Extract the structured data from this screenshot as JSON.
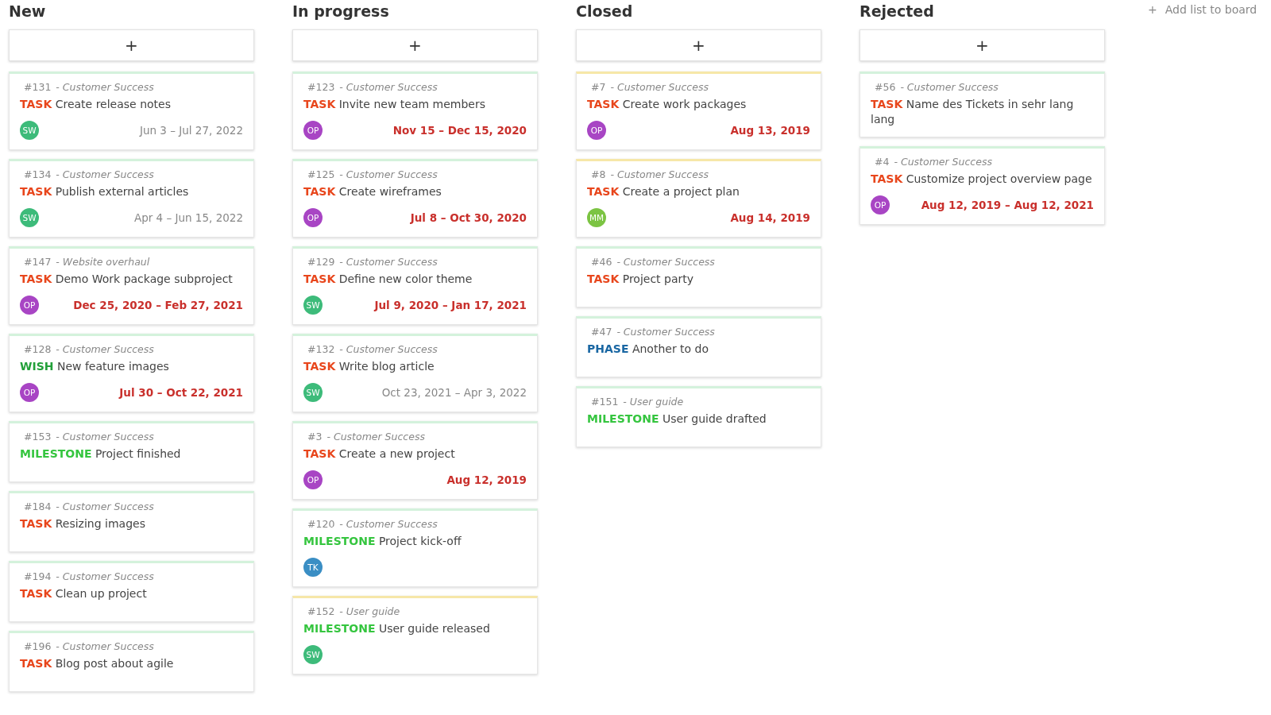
{
  "add_list": {
    "icon": "+",
    "label": "Add list to board"
  },
  "columns": [
    {
      "title": "New",
      "add_button": "+",
      "cards": [
        {
          "number": "#131",
          "project": "- Customer Success",
          "kind": "task",
          "type": "TASK",
          "subject": "Create release notes",
          "color": "#d4f2dc",
          "avatar": {
            "initials": "SW",
            "color": "#3dbb7a"
          },
          "dates": "Jun 3 – Jul 27, 2022",
          "overdue": false
        },
        {
          "number": "#134",
          "project": "- Customer Success",
          "kind": "task",
          "type": "TASK",
          "subject": "Publish external articles",
          "color": "#d4f2dc",
          "avatar": {
            "initials": "SW",
            "color": "#3dbb7a"
          },
          "dates": "Apr 4 – Jun 15, 2022",
          "overdue": false
        },
        {
          "number": "#147",
          "project": "- Website overhaul",
          "kind": "task",
          "type": "TASK",
          "subject": "Demo Work package subproject",
          "color": "#d4f2dc",
          "avatar": {
            "initials": "OP",
            "color": "#a845c4"
          },
          "dates": "Dec 25, 2020 – Feb 27, 2021",
          "overdue": true
        },
        {
          "number": "#128",
          "project": "- Customer Success",
          "kind": "wish",
          "type": "WISH",
          "subject": "New feature images",
          "color": "#d4f2dc",
          "avatar": {
            "initials": "OP",
            "color": "#a845c4"
          },
          "dates": "Jul 30 – Oct 22, 2021",
          "overdue": true
        },
        {
          "number": "#153",
          "project": "- Customer Success",
          "kind": "milestone",
          "type": "MILESTONE",
          "subject": "Project finished",
          "color": "#d4f2dc"
        },
        {
          "number": "#184",
          "project": "- Customer Success",
          "kind": "task",
          "type": "TASK",
          "subject": "Resizing images",
          "color": "#d4f2dc"
        },
        {
          "number": "#194",
          "project": "- Customer Success",
          "kind": "task",
          "type": "TASK",
          "subject": "Clean up project",
          "color": "#d4f2dc"
        },
        {
          "number": "#196",
          "project": "- Customer Success",
          "kind": "task",
          "type": "TASK",
          "subject": "Blog post about agile",
          "color": "#d4f2dc"
        }
      ]
    },
    {
      "title": "In progress",
      "add_button": "+",
      "cards": [
        {
          "number": "#123",
          "project": "- Customer Success",
          "kind": "task",
          "type": "TASK",
          "subject": "Invite new team members",
          "color": "#d4f2dc",
          "avatar": {
            "initials": "OP",
            "color": "#a845c4"
          },
          "dates": "Nov 15 – Dec 15, 2020",
          "overdue": true
        },
        {
          "number": "#125",
          "project": "- Customer Success",
          "kind": "task",
          "type": "TASK",
          "subject": "Create wireframes",
          "color": "#d4f2dc",
          "avatar": {
            "initials": "OP",
            "color": "#a845c4"
          },
          "dates": "Jul 8 – Oct 30, 2020",
          "overdue": true
        },
        {
          "number": "#129",
          "project": "- Customer Success",
          "kind": "task",
          "type": "TASK",
          "subject": "Define new color theme",
          "color": "#d4f2dc",
          "avatar": {
            "initials": "SW",
            "color": "#3dbb7a"
          },
          "dates": "Jul 9, 2020 – Jan 17, 2021",
          "overdue": true
        },
        {
          "number": "#132",
          "project": "- Customer Success",
          "kind": "task",
          "type": "TASK",
          "subject": "Write blog article",
          "color": "#d4f2dc",
          "avatar": {
            "initials": "SW",
            "color": "#3dbb7a"
          },
          "dates": "Oct 23, 2021 – Apr 3, 2022",
          "overdue": false
        },
        {
          "number": "#3",
          "project": "- Customer Success",
          "kind": "task",
          "type": "TASK",
          "subject": "Create a new project",
          "color": "#d4f2dc",
          "avatar": {
            "initials": "OP",
            "color": "#a845c4"
          },
          "dates": "Aug 12, 2019",
          "overdue": true
        },
        {
          "number": "#120",
          "project": "- Customer Success",
          "kind": "milestone",
          "type": "MILESTONE",
          "subject": "Project kick-off",
          "color": "#d4f2dc",
          "avatar": {
            "initials": "TK",
            "color": "#3a8ec4"
          }
        },
        {
          "number": "#152",
          "project": "- User guide",
          "kind": "milestone",
          "type": "MILESTONE",
          "subject": "User guide released",
          "color": "#f6e7a8",
          "avatar": {
            "initials": "SW",
            "color": "#3dbb7a"
          }
        }
      ]
    },
    {
      "title": "Closed",
      "add_button": "+",
      "cards": [
        {
          "number": "#7",
          "project": "- Customer Success",
          "kind": "task",
          "type": "TASK",
          "subject": "Create work packages",
          "color": "#f6e7a8",
          "avatar": {
            "initials": "OP",
            "color": "#a845c4"
          },
          "dates": "Aug 13, 2019",
          "overdue": true
        },
        {
          "number": "#8",
          "project": "- Customer Success",
          "kind": "task",
          "type": "TASK",
          "subject": "Create a project plan",
          "color": "#f6e7a8",
          "avatar": {
            "initials": "MM",
            "color": "#7cc443"
          },
          "dates": "Aug 14, 2019",
          "overdue": true
        },
        {
          "number": "#46",
          "project": "- Customer Success",
          "kind": "task",
          "type": "TASK",
          "subject": "Project party",
          "color": "#d4f2dc"
        },
        {
          "number": "#47",
          "project": "- Customer Success",
          "kind": "phase",
          "type": "PHASE",
          "subject": "Another to do",
          "color": "#d4f2dc"
        },
        {
          "number": "#151",
          "project": "- User guide",
          "kind": "milestone",
          "type": "MILESTONE",
          "subject": "User guide drafted",
          "color": "#d4f2dc"
        }
      ]
    },
    {
      "title": "Rejected",
      "add_button": "+",
      "cards": [
        {
          "number": "#56",
          "project": "- Customer Success",
          "kind": "task",
          "type": "TASK",
          "subject": "Name des Tickets in sehr lang lang",
          "color": "#d4f2dc"
        },
        {
          "number": "#4",
          "project": "- Customer Success",
          "kind": "task",
          "type": "TASK",
          "subject": "Customize project overview page",
          "color": "#d4f2dc",
          "avatar": {
            "initials": "OP",
            "color": "#a845c4"
          },
          "dates": "Aug 12, 2019 – Aug 12, 2021",
          "overdue": true
        }
      ]
    }
  ]
}
